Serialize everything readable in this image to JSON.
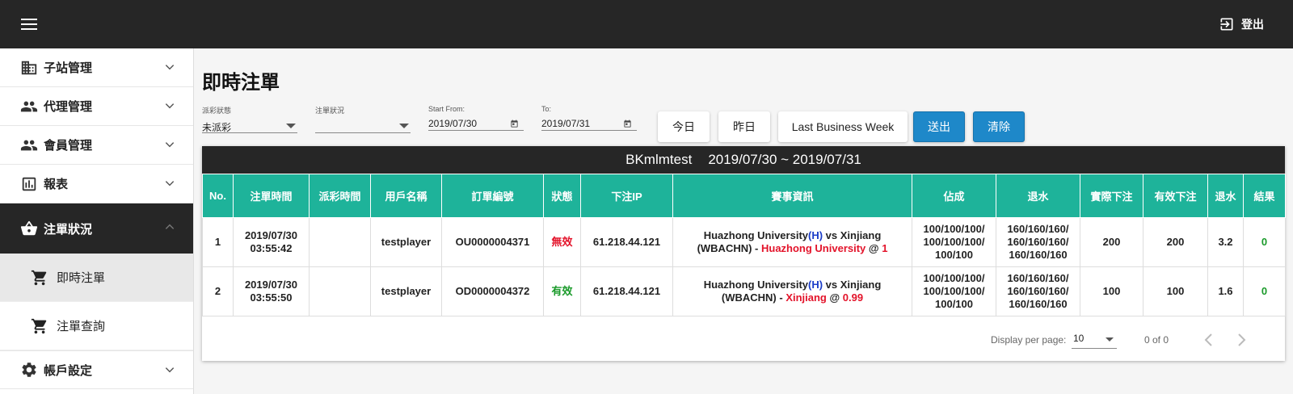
{
  "header": {
    "logout_label": "登出"
  },
  "sidebar": {
    "items": [
      {
        "label": "子站管理",
        "icon": "building-icon"
      },
      {
        "label": "代理管理",
        "icon": "people-icon"
      },
      {
        "label": "會員管理",
        "icon": "people-icon"
      },
      {
        "label": "報表",
        "icon": "chart-icon"
      },
      {
        "label": "注單狀況",
        "icon": "basket-icon",
        "active": true
      },
      {
        "label": "帳戶設定",
        "icon": "gear-icon"
      }
    ],
    "subitems": [
      {
        "label": "即時注單",
        "icon": "cart-icon",
        "selected": true
      },
      {
        "label": "注單查詢",
        "icon": "cart-icon"
      }
    ]
  },
  "page": {
    "title": "即時注單"
  },
  "filters": {
    "payout_status": {
      "label": "派彩狀態",
      "value": "未派彩"
    },
    "bet_status": {
      "label": "注單狀況",
      "value": ""
    },
    "start": {
      "label": "Start From:",
      "value": "2019/07/30"
    },
    "end": {
      "label": "To:",
      "value": "2019/07/31"
    }
  },
  "buttons": {
    "today": "今日",
    "yesterday": "昨日",
    "last_week": "Last Business Week",
    "submit": "送出",
    "clear": "清除"
  },
  "table": {
    "caption_user": "BKmlmtest",
    "caption_range": "2019/07/30 ~ 2019/07/31",
    "headers": [
      "No.",
      "注單時間",
      "派彩時間",
      "用戶名稱",
      "訂單編號",
      "狀態",
      "下注IP",
      "賽事資訊",
      "佔成",
      "退水",
      "實際下注",
      "有效下注",
      "退水",
      "結果"
    ],
    "rows": [
      {
        "no": "1",
        "bet_date": "2019/07/30",
        "bet_time": "03:55:42",
        "payout_time": "",
        "user": "testplayer",
        "order": "OU0000004371",
        "status": "無效",
        "ip": "61.218.44.121",
        "event_home": "Huazhong University",
        "event_h": "(H)",
        "event_vs": " vs Xinjiang",
        "event_league": "(WBACHN) - ",
        "event_pick": "Huazhong University",
        "event_at": " @ ",
        "event_odds": "1",
        "share1": "100/100/100/",
        "share2": "100/100/100/",
        "share3": "100/100",
        "rebate1": "160/160/160/",
        "rebate2": "160/160/160/",
        "rebate3": "160/160/160",
        "actual": "200",
        "valid": "200",
        "rebate_amt": "3.2",
        "result": "0"
      },
      {
        "no": "2",
        "bet_date": "2019/07/30",
        "bet_time": "03:55:50",
        "payout_time": "",
        "user": "testplayer",
        "order": "OD0000004372",
        "status": "有效",
        "ip": "61.218.44.121",
        "event_home": "Huazhong University",
        "event_h": "(H)",
        "event_vs": " vs Xinjiang",
        "event_league": "(WBACHN) - ",
        "event_pick": "Xinjiang",
        "event_at": " @ ",
        "event_odds": "0.99",
        "share1": "100/100/100/",
        "share2": "100/100/100/",
        "share3": "100/100",
        "rebate1": "160/160/160/",
        "rebate2": "160/160/160/",
        "rebate3": "160/160/160",
        "actual": "100",
        "valid": "100",
        "rebate_amt": "1.6",
        "result": "0"
      }
    ]
  },
  "pagination": {
    "per_page_label": "Display per page:",
    "per_page_value": "10",
    "range": "0 of 0"
  },
  "colors": {
    "accent": "#1eb39a",
    "primary_button": "#1e88c9",
    "dark": "#262626",
    "invalid": "#e3132a",
    "valid": "#1a9a2a"
  }
}
